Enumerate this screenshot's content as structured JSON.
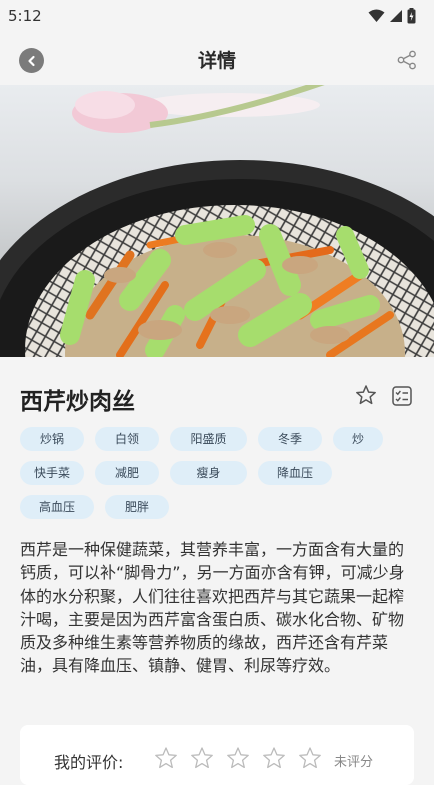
{
  "status_bar": {
    "time": "5:12"
  },
  "header": {
    "title": "详情"
  },
  "recipe": {
    "title": "西芹炒肉丝",
    "tags": [
      [
        "炒锅",
        "白领",
        "阳盛质",
        "冬季",
        "炒"
      ],
      [
        "快手菜",
        "减肥",
        "瘦身",
        "降血压"
      ],
      [
        "高血压",
        "肥胖"
      ]
    ],
    "description": "西芹是一种保健蔬菜，其营养丰富，一方面含有大量的钙质，可以补“脚骨力”，另一方面亦含有钾，可减少身体的水分积聚，人们往往喜欢把西芹与其它蔬果一起榨汁喝，主要是因为西芹富含蛋白质、碳水化合物、矿物质及多种维生素等营养物质的缘故，西芹还含有芹菜油，具有降血压、镇静、健胃、利尿等疗效。"
  },
  "rating": {
    "label": "我的评价:",
    "stars_total": 5,
    "stars_filled": 0,
    "status": "未评分"
  },
  "colors": {
    "tag_bg": "#dfeef8",
    "back_button_bg": "#7b7b7b"
  }
}
